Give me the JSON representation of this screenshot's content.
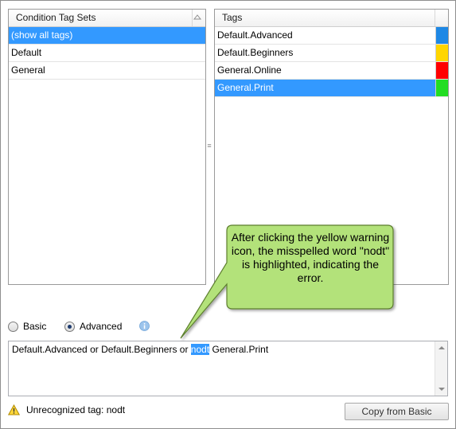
{
  "left_panel": {
    "header": "Condition Tag Sets",
    "items": [
      {
        "label": "(show all tags)",
        "selected": true
      },
      {
        "label": "Default",
        "selected": false
      },
      {
        "label": "General",
        "selected": false
      }
    ]
  },
  "right_panel": {
    "header": "Tags",
    "items": [
      {
        "label": "Default.Advanced",
        "color": "#1e88e5",
        "selected": false
      },
      {
        "label": "Default.Beginners",
        "color": "#ffd600",
        "selected": false
      },
      {
        "label": "General.Online",
        "color": "#ff0000",
        "selected": false
      },
      {
        "label": "General.Print",
        "color": "#22dd22",
        "selected": true
      }
    ]
  },
  "mode": {
    "basic_label": "Basic",
    "advanced_label": "Advanced",
    "selected": "Advanced"
  },
  "expression": {
    "before": "Default.Advanced or Default.Beginners or ",
    "highlighted": "nodt",
    "after": " General.Print"
  },
  "status": {
    "message": "Unrecognized tag: nodt"
  },
  "buttons": {
    "copy_from_basic": "Copy from Basic"
  },
  "callout": {
    "text": "After clicking the yellow warning icon, the misspelled word \"nodt\" is highlighted, indicating the error.",
    "fill": "#b3e27a"
  },
  "colors": {
    "selection": "#3399ff"
  }
}
